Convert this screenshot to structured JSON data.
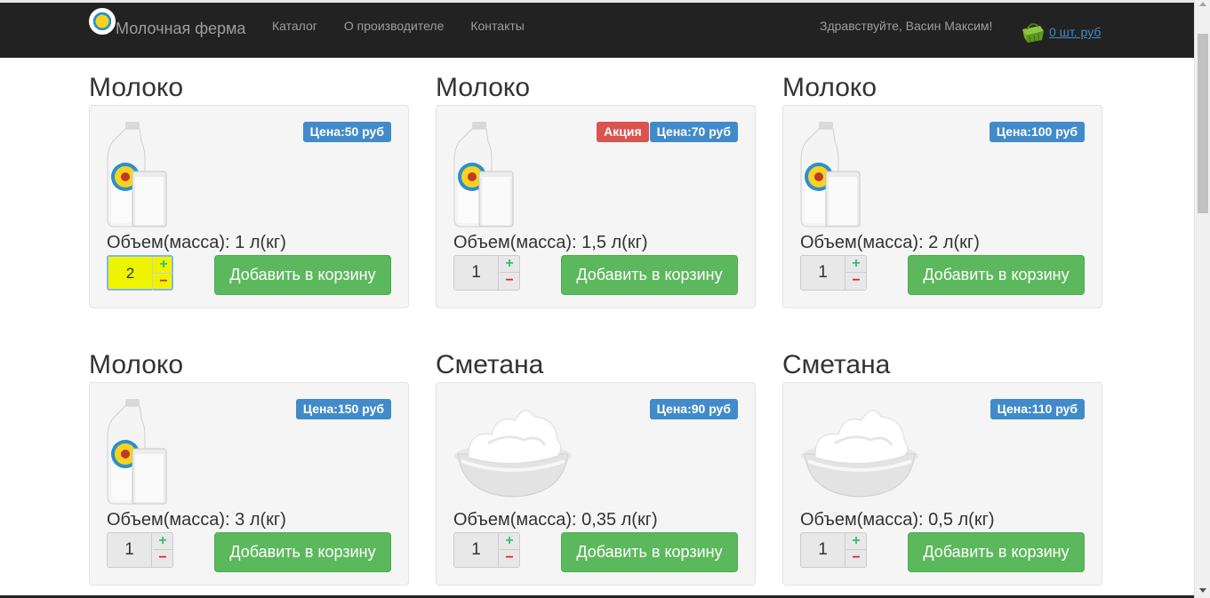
{
  "brand": {
    "name": "Молочная ферма"
  },
  "nav": {
    "items": [
      "Каталог",
      "О производителе",
      "Контакты"
    ]
  },
  "user": {
    "greeting": "Здравствуйте, Васин Максим!"
  },
  "cart": {
    "summary": "0 шт. руб"
  },
  "products": [
    {
      "title": "Молоко",
      "image": "milk-bottle-glass",
      "promo": "",
      "price": "Цена:50 руб",
      "volume": "Объем(масса): 1 л(кг)",
      "qty": "2",
      "add_label": "Добавить в корзину"
    },
    {
      "title": "Молоко",
      "image": "milk-bottle-glass",
      "promo": "Акция",
      "price": "Цена:70 руб",
      "volume": "Объем(масса): 1,5 л(кг)",
      "qty": "1",
      "add_label": "Добавить в корзину"
    },
    {
      "title": "Молоко",
      "image": "milk-bottle-glass",
      "promo": "",
      "price": "Цена:100 руб",
      "volume": "Объем(масса): 2 л(кг)",
      "qty": "1",
      "add_label": "Добавить в корзину"
    },
    {
      "title": "Молоко",
      "image": "milk-bottle-glass",
      "promo": "",
      "price": "Цена:150 руб",
      "volume": "Объем(масса): 3 л(кг)",
      "qty": "1",
      "add_label": "Добавить в корзину"
    },
    {
      "title": "Сметана",
      "image": "sour-cream-bowl",
      "promo": "",
      "price": "Цена:90 руб",
      "volume": "Объем(масса): 0,35 л(кг)",
      "qty": "1",
      "add_label": "Добавить в корзину"
    },
    {
      "title": "Сметана",
      "image": "sour-cream-bowl",
      "promo": "",
      "price": "Цена:110 руб",
      "volume": "Объем(масса): 0,5 л(кг)",
      "qty": "1",
      "add_label": "Добавить в корзину"
    }
  ],
  "colors": {
    "navbar": "#222222",
    "price_badge": "#428bca",
    "promo_badge": "#d9534f",
    "add_button": "#5cb85c",
    "active_qty": "#eef400"
  }
}
